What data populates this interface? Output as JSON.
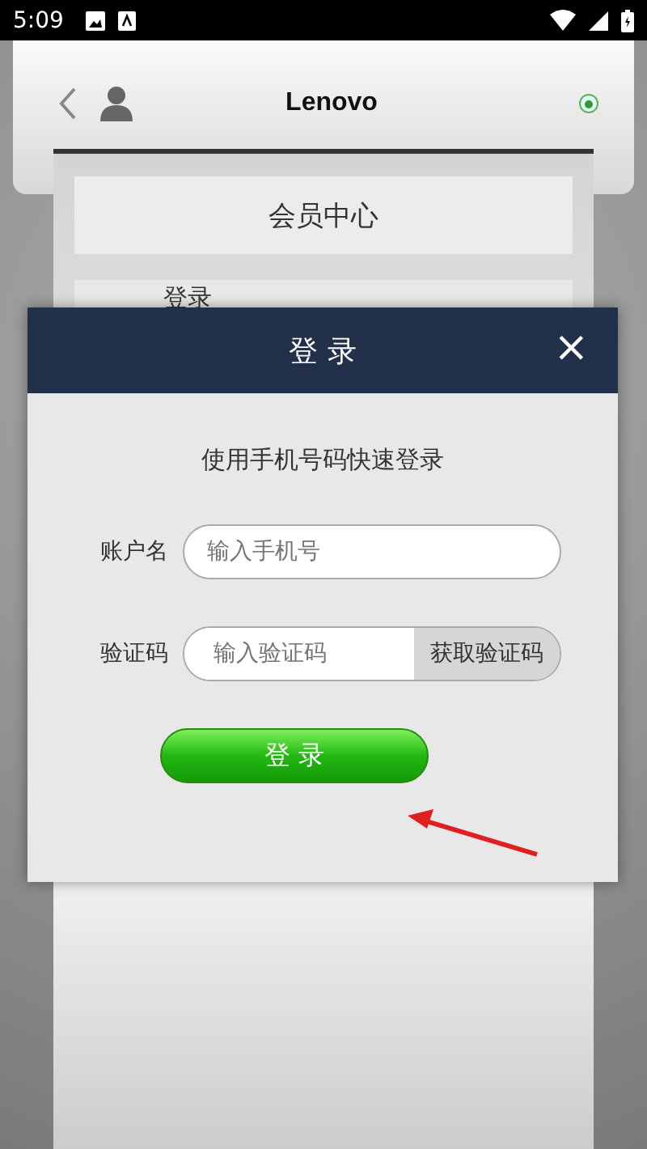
{
  "status_bar": {
    "time": "5:09"
  },
  "header": {
    "logo": "Lenovo"
  },
  "page": {
    "title": "会员中心",
    "menu_items": [
      {
        "label": "登录"
      }
    ]
  },
  "dialog": {
    "title": "登 录",
    "close": "×",
    "subtitle": "使用手机号码快速登录",
    "fields": [
      {
        "kind": "text",
        "label": "账户名",
        "placeholder": "输入手机号"
      },
      {
        "kind": "code",
        "label": "验证码",
        "placeholder": "输入验证码",
        "button": "获取验证码"
      }
    ],
    "submit": "登 录"
  }
}
